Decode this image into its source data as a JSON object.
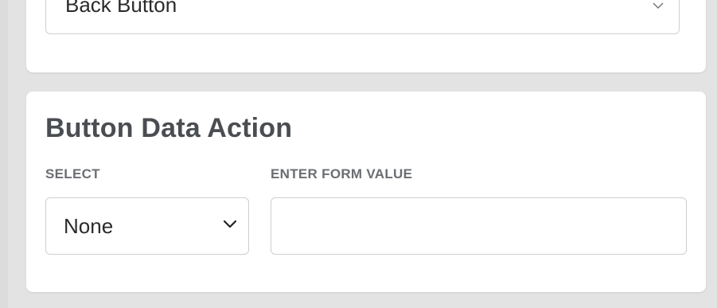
{
  "previous_section": {
    "select_value": "Back Button"
  },
  "button_data_action": {
    "title": "Button Data Action",
    "select_label": "SELECT",
    "select_value": "None",
    "value_label": "ENTER FORM VALUE",
    "value_input": "",
    "value_placeholder": ""
  },
  "icons": {
    "dropdown": "chevron-down-icon"
  }
}
